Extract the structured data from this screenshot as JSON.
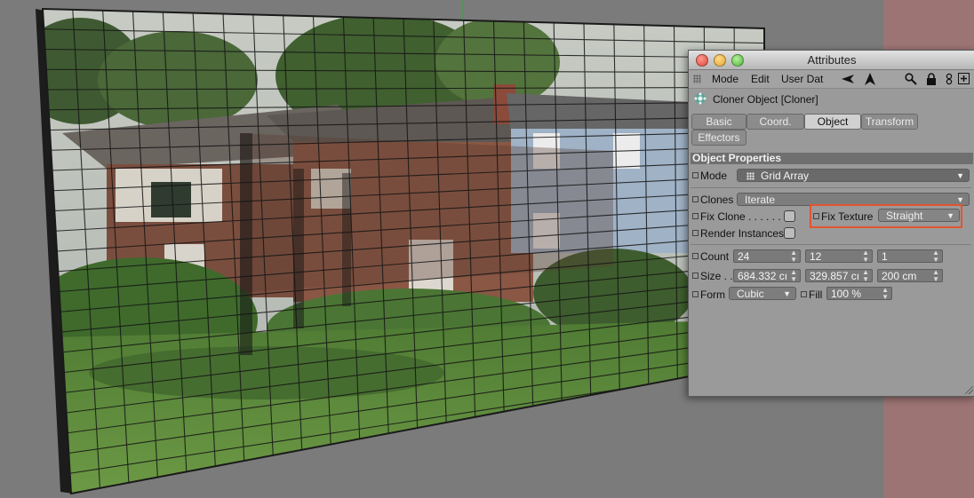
{
  "window": {
    "title": "Attributes"
  },
  "menu": {
    "mode": "Mode",
    "edit": "Edit",
    "user_data": "User Dat"
  },
  "object": {
    "title": "Cloner Object [Cloner]"
  },
  "tabs": {
    "basic": "Basic",
    "coord": "Coord.",
    "object": "Object",
    "transform": "Transform",
    "effectors": "Effectors",
    "active": "Object"
  },
  "section": {
    "title": "Object Properties"
  },
  "props": {
    "mode_label": "Mode",
    "mode_value": "Grid Array",
    "clones_label": "Clones",
    "clones_value": "Iterate",
    "fix_clone_label": "Fix Clone . . . . . .",
    "fix_clone_checked": false,
    "fix_texture_label": "Fix Texture",
    "fix_texture_value": "Straight",
    "render_instances_label": "Render Instances",
    "render_instances_checked": false,
    "count_label": "Count",
    "count_x": "24",
    "count_y": "12",
    "count_z": "1",
    "size_label": "Size . .",
    "size_x": "684.332 cı",
    "size_y": "329.857 cı",
    "size_z": "200 cm",
    "form_label": "Form",
    "form_value": "Cubic",
    "fill_label": "Fill",
    "fill_value": "100 %"
  },
  "icons": [
    "close-light",
    "minimize-light",
    "maximize-light",
    "arrow-left-icon",
    "arrow-up-icon",
    "search-icon",
    "lock-icon",
    "link-icon",
    "new-panel-icon",
    "cloner-icon"
  ],
  "colors": {
    "highlight": "#e4532e",
    "viewport_bg": "#7b7b7b",
    "panel_bg": "#9a9a9a"
  }
}
